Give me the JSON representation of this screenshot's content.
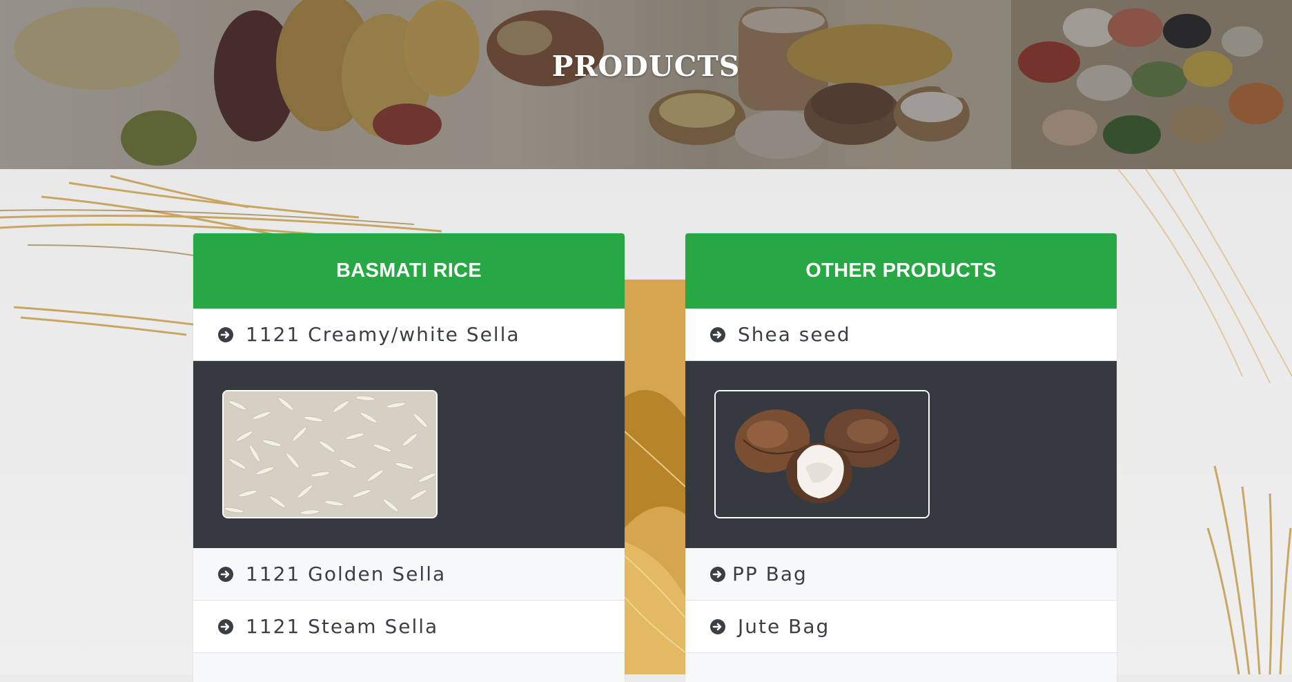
{
  "banner": {
    "title": "PRODUCTS"
  },
  "cards": [
    {
      "header": "BASMATI RICE",
      "items": [
        "1121 Creamy/white Sella",
        "1121 Golden Sella",
        "1121 Steam Sella"
      ],
      "image_name": "basmati-rice-image"
    },
    {
      "header": "OTHER PRODUCTS",
      "items": [
        "Shea seed",
        "PP Bag",
        "Jute Bag"
      ],
      "image_name": "shea-seed-image"
    }
  ],
  "colors": {
    "header_green": "#28a745",
    "panel_dark": "#343a40",
    "text_dark": "#3a3f45"
  },
  "icons": {
    "item_bullet": "arrow-circle-right-icon"
  }
}
